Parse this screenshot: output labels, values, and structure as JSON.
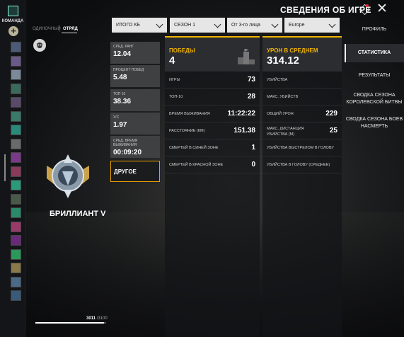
{
  "header": {
    "title": "СВЕДЕНИЯ ОБ ИГРЕ",
    "close_icon": "close-icon"
  },
  "leftbar": {
    "team_label": "КОМАНДА",
    "add_symbol": "+",
    "avatars": [
      "#4c5a7a",
      "#6a5a8a",
      "#7a8a9a",
      "#3a6a5a",
      "#5a4a6a",
      "#3a7a6a",
      "#2a8a7a",
      "#6a6a6a",
      "#7a3a8a",
      "#8a3a5a",
      "#2a9a7a",
      "#4a5a4a",
      "#2a8a6a",
      "#9a3a6a",
      "#6a2a7a",
      "#2a9a5a",
      "#8a7a4a",
      "#4a6a8a",
      "#3a5a7a"
    ]
  },
  "mode_tabs": {
    "inactive": "ОДИНОЧНЫЙ",
    "active": "ОТРЯД"
  },
  "filters": [
    "ИТОГО КБ",
    "СЕЗОН 1",
    "От 3-го лица",
    "Europe"
  ],
  "right_nav": {
    "items": [
      "ПРОФИЛЬ",
      "СТАТИСТИКА",
      "РЕЗУЛЬТАТЫ",
      "СВОДКА СЕЗОНА КОРОЛЕВСКОЙ БИТВЫ",
      "СВОДКА СЕЗОНА БОЕВ НАСМЕРТЬ"
    ],
    "selected_index": 1
  },
  "rank": {
    "name": "БРИЛЛИАНТ V",
    "progress_current": "3011",
    "progress_max": "/3100",
    "progress_fraction": 0.97
  },
  "left_stats": [
    {
      "label": "СРЕД. РАНГ",
      "value": "12.04"
    },
    {
      "label": "ПРОЦЕНТ ПОБЕД",
      "value": "5.48"
    },
    {
      "label": "ТОП 10",
      "value": "38.36"
    },
    {
      "label": "У/С",
      "value": "1.97"
    },
    {
      "label": "СРЕД. ВРЕМЯ ВЫЖИВАНИЯ",
      "value": "00:09:20"
    }
  ],
  "other_button": "ДРУГОЕ",
  "wins_panel": {
    "title": "ПОБЕДЫ",
    "value": "4",
    "rows": [
      {
        "label": "ИГРЫ",
        "value": "73"
      },
      {
        "label": "ТОП-10",
        "value": "28"
      },
      {
        "label": "ВРЕМЯ ВЫЖИВАНИЯ",
        "value": "11:22:22"
      },
      {
        "label": "РАССТОЯНИЕ (КМ)",
        "value": "151.38"
      },
      {
        "label": "СМЕРТЕЙ В СИНЕЙ ЗОНЕ",
        "value": "1"
      },
      {
        "label": "СМЕРТЕЙ В КРАСНОЙ ЗОНЕ",
        "value": "0"
      }
    ]
  },
  "damage_panel": {
    "title": "УРОН В СРЕДНЕМ",
    "value": "314.12",
    "rows": [
      {
        "label": "УБИЙСТВА",
        "value": ""
      },
      {
        "label": "МАКС. УБИЙСТВ",
        "value": ""
      },
      {
        "label": "ОБЩИЙ УРОН",
        "value": "229"
      },
      {
        "label": "МАКС. ДИСТАНЦИЯ УБИЙСТВА (М)",
        "value": "25"
      },
      {
        "label": "УБИЙСТВА ВЫСТРЕЛОМ В ГОЛОВУ",
        "value": ""
      },
      {
        "label": "УБИЙСТВА В ГОЛОВУ (СРЕДНЕЕ)",
        "value": ""
      }
    ]
  },
  "colors": {
    "accent": "#f0b400",
    "panel": "#2c2d30",
    "filter_bg": "#e6e6e6"
  }
}
